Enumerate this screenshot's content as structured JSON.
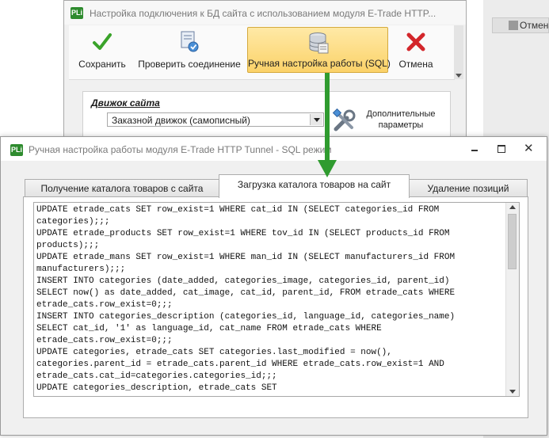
{
  "background": {
    "cancel_label": "Отмена"
  },
  "main_window": {
    "title": "Настройка подключения к БД сайта с использованием модуля E-Trade HTTP...",
    "app_icon_text": "PLi",
    "toolbar": {
      "save_label": "Сохранить",
      "check_connection_label": "Проверить соединение",
      "manual_sql_label": "Ручная настройка работы (SQL)",
      "cancel_label": "Отмена"
    },
    "engine_label": "Движок сайта",
    "engine_value": "Заказной движок (самописный)",
    "extra_params_label": "Дополнительные параметры"
  },
  "sql_window": {
    "title": "Ручная настройка работы модуля E-Trade HTTP Tunnel - SQL режим",
    "app_icon_text": "PLi",
    "tabs": [
      {
        "label": "Получение каталога товаров с сайта",
        "active": false
      },
      {
        "label": "Загрузка каталога товаров на сайт",
        "active": true
      },
      {
        "label": "Удаление позиций",
        "active": false
      }
    ],
    "sql_lines": "UPDATE etrade_cats SET row_exist=1 WHERE cat_id IN (SELECT categories_id FROM\ncategories);;;\nUPDATE etrade_products SET row_exist=1 WHERE tov_id IN (SELECT products_id FROM\nproducts);;;\nUPDATE etrade_mans SET row_exist=1 WHERE man_id IN (SELECT manufacturers_id FROM\nmanufacturers);;;\nINSERT INTO categories (date_added, categories_image, categories_id, parent_id)\nSELECT now() as date_added, cat_image, cat_id, parent_id, FROM etrade_cats WHERE\netrade_cats.row_exist=0;;;\nINSERT INTO categories_description (categories_id, language_id, categories_name)\nSELECT cat_id, '1' as language_id, cat_name FROM etrade_cats WHERE\netrade_cats.row_exist=0;;;\nUPDATE categories, etrade_cats SET categories.last_modified = now(),\ncategories.parent_id = etrade_cats.parent_id WHERE etrade_cats.row_exist=1 AND\netrade_cats.cat_id=categories.categories_id;;;\nUPDATE categories_description, etrade_cats SET"
  },
  "colors": {
    "accent_active": "#fbd269",
    "arrow": "#2f9b2f",
    "app_icon": "#2e8b2e"
  }
}
